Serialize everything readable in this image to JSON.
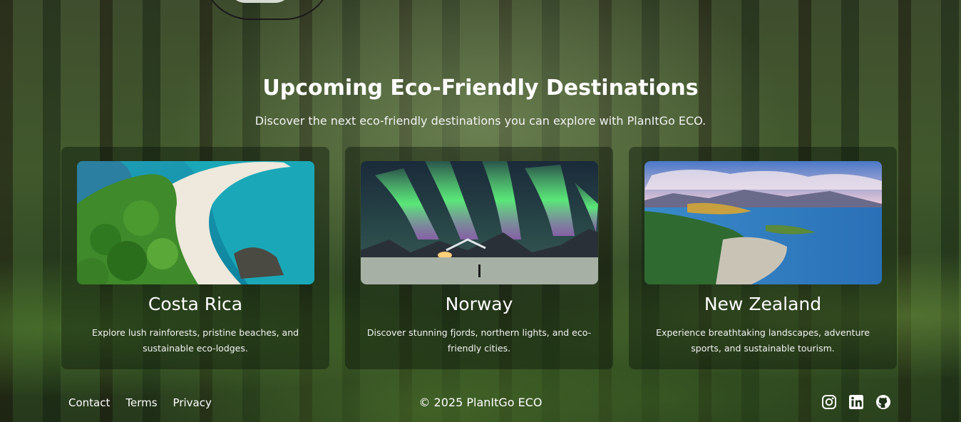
{
  "section": {
    "title": "Upcoming Eco-Friendly Destinations",
    "subtitle": "Discover the next eco-friendly destinations you can explore with PlanItGo ECO."
  },
  "cards": [
    {
      "name": "Costa Rica",
      "description": "Explore lush rainforests, pristine beaches, and sustainable eco-lodges."
    },
    {
      "name": "Norway",
      "description": "Discover stunning fjords, northern lights, and eco-friendly cities."
    },
    {
      "name": "New Zealand",
      "description": "Experience breathtaking landscapes, adventure sports, and sustainable tourism."
    }
  ],
  "footer": {
    "links": [
      "Contact",
      "Terms",
      "Privacy"
    ],
    "copyright": "© 2025 PlanItGo ECO",
    "social_icons": [
      "instagram-icon",
      "linkedin-icon",
      "github-icon"
    ]
  }
}
